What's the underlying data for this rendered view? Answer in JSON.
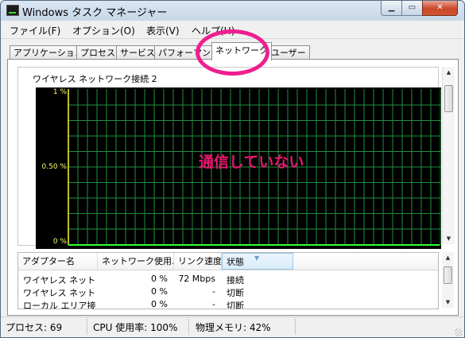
{
  "window": {
    "title": "Windows タスク マネージャー",
    "app_icon": "task-manager-icon",
    "minimize_glyph": "▁",
    "maximize_glyph": "▭",
    "close_glyph": "✕"
  },
  "menu": [
    {
      "label": "ファイル(F)"
    },
    {
      "label": "オプション(O)"
    },
    {
      "label": "表示(V)"
    },
    {
      "label": "ヘルプ(H)"
    }
  ],
  "tabs": [
    {
      "label": "アプリケーション",
      "active": false
    },
    {
      "label": "プロセス",
      "active": false
    },
    {
      "label": "サービス",
      "active": false
    },
    {
      "label": "パフォーマンス",
      "active": false
    },
    {
      "label": "ネットワーク",
      "active": true
    },
    {
      "label": "ユーザー",
      "active": false
    }
  ],
  "graph": {
    "title": "ワイヤレス ネットワーク接続 2",
    "y_labels": [
      "1 %",
      "0.50 %",
      "0 %"
    ],
    "annotation": "通信していない",
    "grid_color": "#1f8f3f",
    "axis_color": "#ffff33",
    "trace_color": "#33ff33"
  },
  "chart_data": {
    "type": "line",
    "ylim": [
      0,
      1
    ],
    "grid": true,
    "series": [
      {
        "values": [
          0,
          0,
          0,
          0,
          0,
          0,
          0,
          0,
          0,
          0
        ]
      }
    ]
  },
  "adapters": {
    "columns": [
      "アダプター名",
      "ネットワーク使用...",
      "リンク速度",
      "状態"
    ],
    "rows": [
      {
        "name": "ワイヤレス ネット...",
        "usage": "0 %",
        "speed": "72 Mbps",
        "state": "接続"
      },
      {
        "name": "ワイヤレス ネット...",
        "usage": "0 %",
        "speed": "-",
        "state": "切断"
      },
      {
        "name": "ローカル エリア接...",
        "usage": "0 %",
        "speed": "-",
        "state": "切断"
      }
    ]
  },
  "status": {
    "processes": "プロセス: 69",
    "cpu": "CPU 使用率: 100%",
    "memory": "物理メモリ: 42%"
  },
  "scroll": {
    "up": "▲",
    "down": "▼"
  },
  "colors": {
    "highlight": "#ee1f8f",
    "annotation": "#e8176f"
  }
}
